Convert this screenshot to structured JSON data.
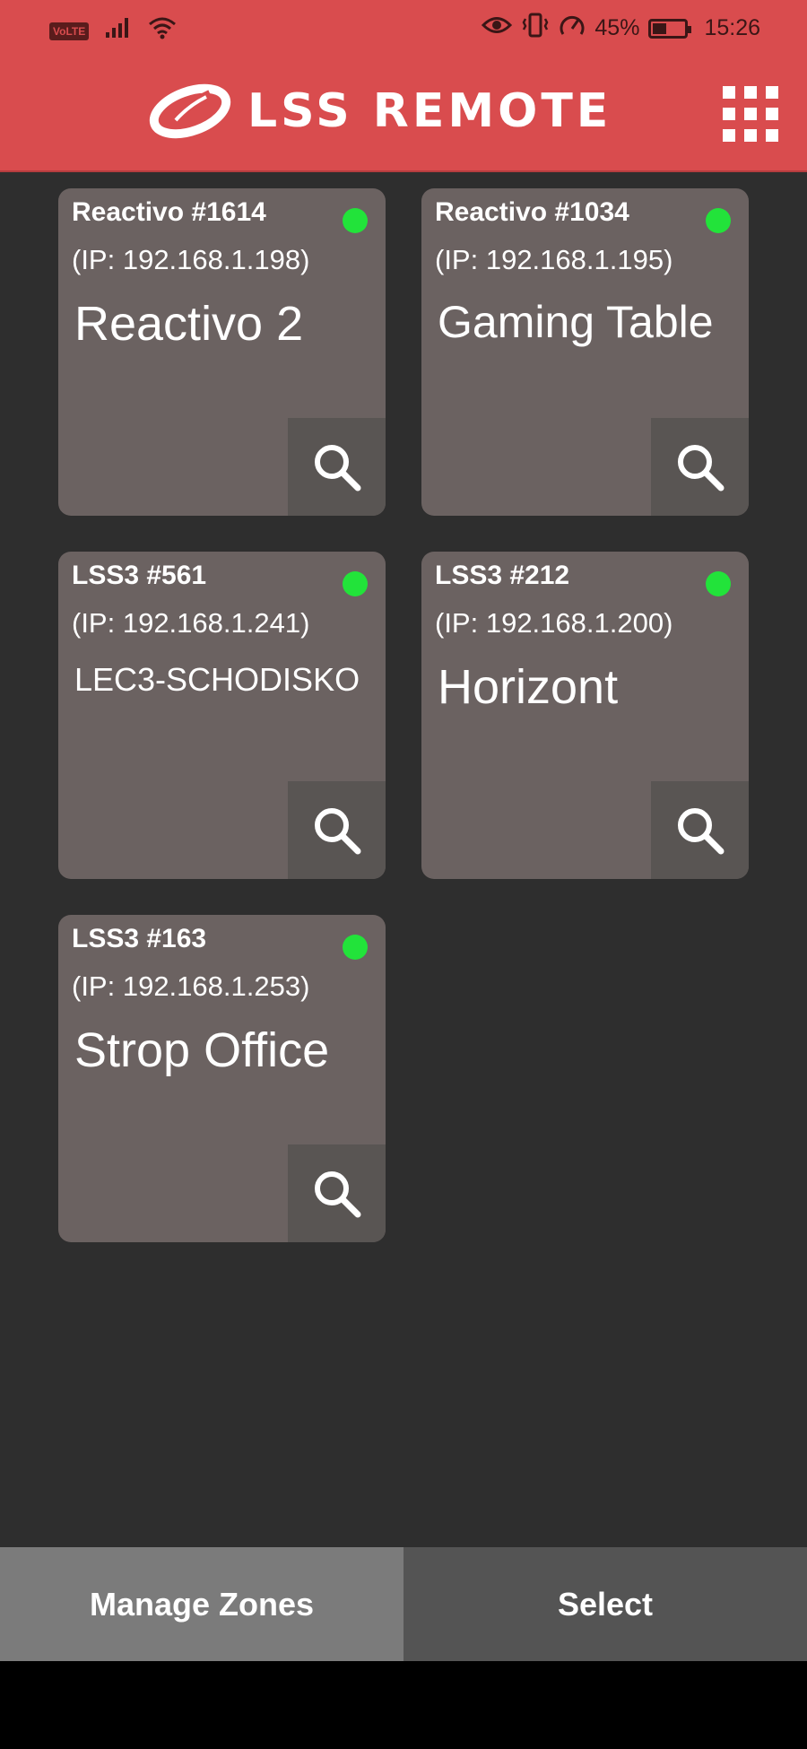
{
  "status_bar": {
    "volte": "VoLTE",
    "battery_percent": "45%",
    "battery_level": 0.45,
    "time": "15:26"
  },
  "header": {
    "logo_text": "LSS REMOTE",
    "menu_icon": "grid-menu-icon"
  },
  "devices": [
    {
      "id_label": "Reactivo #1614",
      "ip": "(IP: 192.168.1.198)",
      "name": "Reactivo 2",
      "online": true,
      "status_color": "#22e33a"
    },
    {
      "id_label": "Reactivo #1034",
      "ip": "(IP: 192.168.1.195)",
      "name": "Gaming Table",
      "online": true,
      "status_color": "#22e33a"
    },
    {
      "id_label": "LSS3 #561",
      "ip": "(IP: 192.168.1.241)",
      "name": "LEC3-SCHODISKO",
      "online": true,
      "status_color": "#22e33a"
    },
    {
      "id_label": "LSS3 #212",
      "ip": "(IP: 192.168.1.200)",
      "name": "Horizont",
      "online": true,
      "status_color": "#22e33a"
    },
    {
      "id_label": "LSS3 #163",
      "ip": "(IP: 192.168.1.253)",
      "name": "Strop Office",
      "online": true,
      "status_color": "#22e33a"
    }
  ],
  "bottom_bar": {
    "manage_label": "Manage Zones",
    "select_label": "Select"
  },
  "colors": {
    "header": "#d94c4e",
    "background": "#2e2e2e",
    "card": "#6b6261",
    "online": "#22e33a"
  }
}
